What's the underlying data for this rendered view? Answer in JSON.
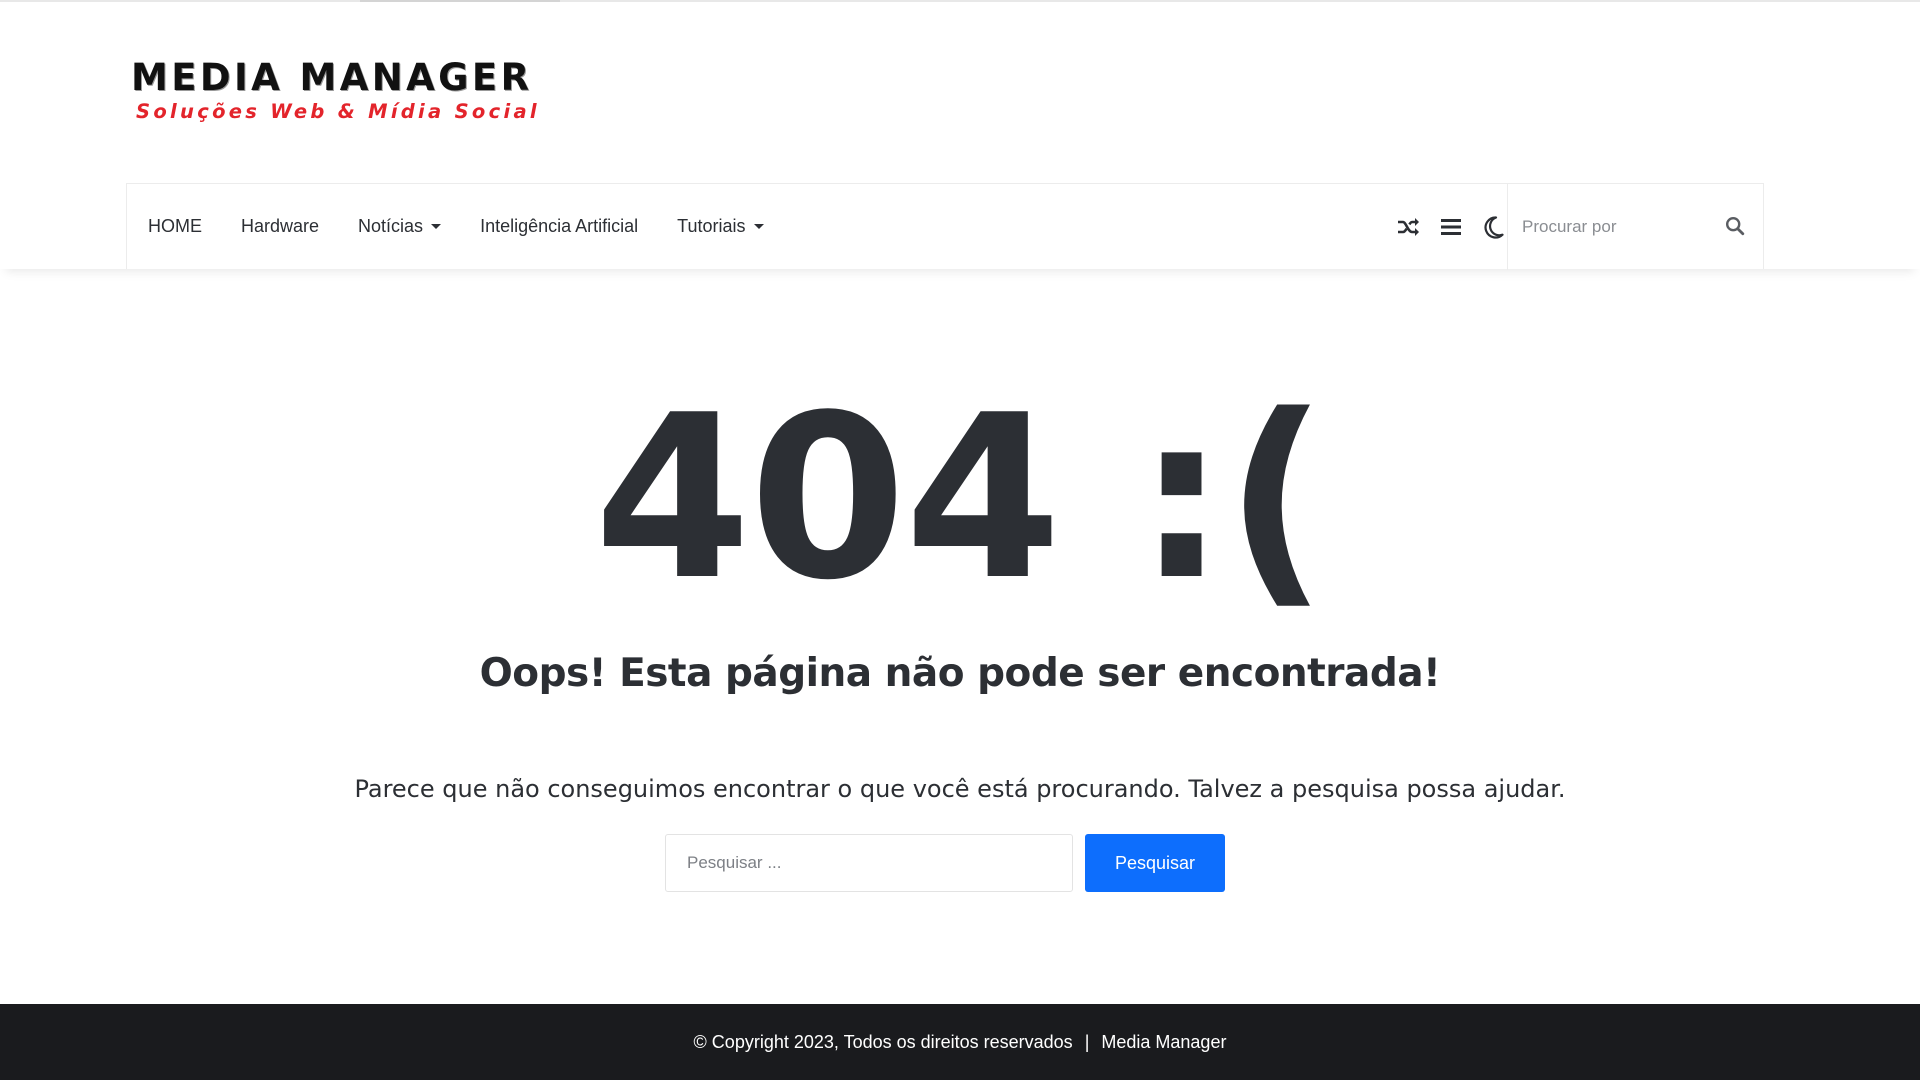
{
  "logo": {
    "title": "MEDIA MANAGER",
    "subtitle": "Soluções Web & Mídia Social",
    "title_color": "#111111",
    "subtitle_color": "#e3242b"
  },
  "nav": {
    "items": [
      {
        "label": "HOME",
        "has_dropdown": false
      },
      {
        "label": "Hardware",
        "has_dropdown": false
      },
      {
        "label": "Notícias",
        "has_dropdown": true
      },
      {
        "label": "Inteligência Artificial",
        "has_dropdown": false
      },
      {
        "label": "Tutoriais",
        "has_dropdown": true
      }
    ],
    "icons": [
      "random-shuffle-icon",
      "menu-list-icon",
      "dark-mode-moon-icon"
    ],
    "search_placeholder": "Procurar por",
    "search_icon": "search-icon"
  },
  "main": {
    "code": "404 :(",
    "heading": "Oops! Esta página não pode ser encontrada!",
    "paragraph": "Parece que não conseguimos encontrar o que você está procurando. Talvez a pesquisa possa ajudar.",
    "search_placeholder": "Pesquisar ...",
    "search_button": "Pesquisar",
    "button_color": "#0d6efd"
  },
  "footer": {
    "copyright": "© Copyright 2023, Todos os direitos reservados",
    "separator": "|",
    "site_name": "Media Manager",
    "background": "#1a1b1e"
  }
}
